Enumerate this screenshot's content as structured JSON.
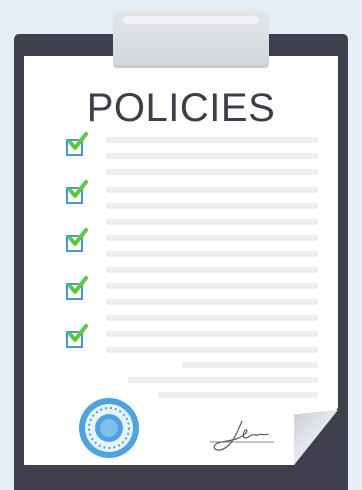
{
  "document": {
    "title": "POLICIES",
    "checkbox_count": 5,
    "colors": {
      "board": "#3f3f4e",
      "paper": "#ffffff",
      "checkbox_border": "#3d9be0",
      "checkmark": "#5cc742",
      "seal": "#4ba3e3",
      "text_lines": "#eceef1"
    },
    "icons": [
      "clipboard-icon",
      "checkbox-checked-icon",
      "seal-icon",
      "signature-icon"
    ]
  }
}
